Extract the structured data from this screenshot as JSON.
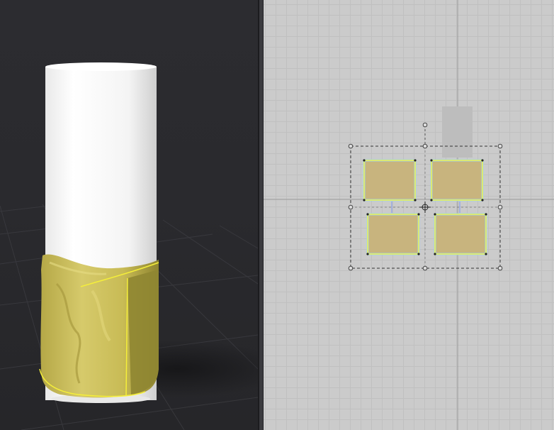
{
  "viewport_3d": {
    "background": "#2a2a2e",
    "cylinder_color": "#f2f2f2",
    "wrap_color": "#c9bd55",
    "wrap_outline_color": "#f5ef3a"
  },
  "uv_editor": {
    "background": "#cbcbcb",
    "island_fill": "#c8b47e",
    "island_edge_color": "#f2f24a",
    "island_outline_color": "#9ad3ee",
    "gizmo_icon": "transform-gizmo"
  }
}
